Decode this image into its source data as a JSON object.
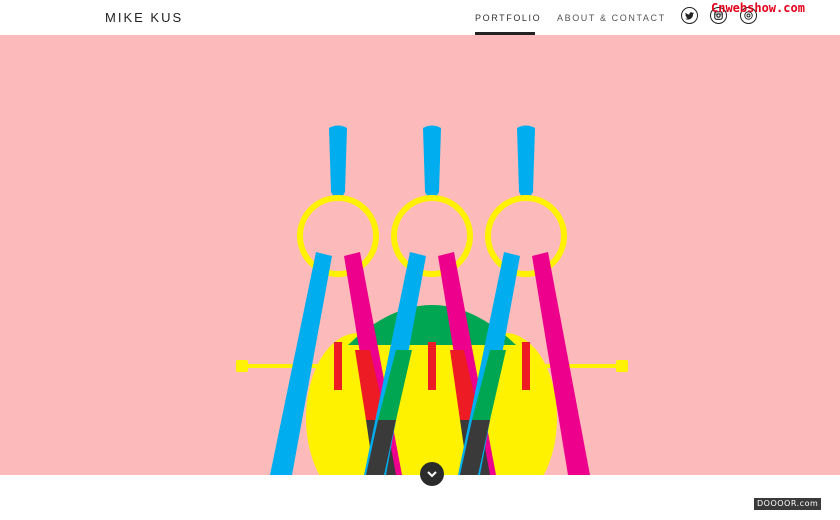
{
  "header": {
    "logo": "MIKE KUS",
    "nav": [
      {
        "label": "PORTFOLIO",
        "active": true
      },
      {
        "label": "ABOUT & CONTACT",
        "active": false
      }
    ],
    "social": [
      {
        "icon": "twitter-icon"
      },
      {
        "icon": "instagram-icon"
      },
      {
        "icon": "dribbble-icon"
      }
    ]
  },
  "hero": {
    "background": "#fdbaba",
    "illustration": "three overlapping drafting compasses",
    "colors": {
      "cyan": "#00aeef",
      "magenta": "#ec008c",
      "yellow": "#fff200",
      "green": "#00a651",
      "red": "#ed1c24",
      "dark": "#3a3a3a"
    }
  },
  "scroll_button": {
    "icon": "chevron-down-icon"
  },
  "watermarks": {
    "top": "Cnwebshow.com",
    "bottom": "DOOOOR.com"
  }
}
